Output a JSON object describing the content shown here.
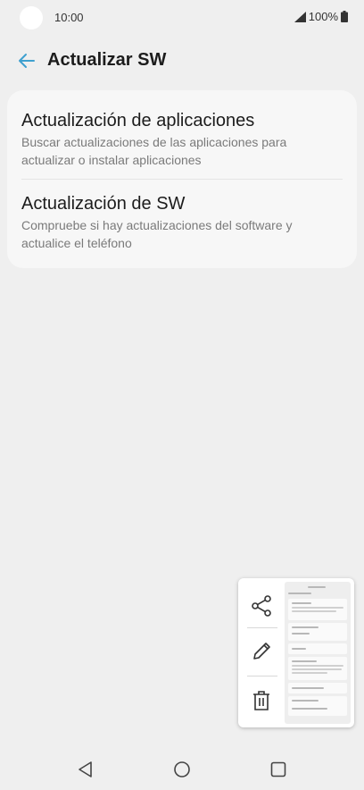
{
  "status_bar": {
    "time": "10:00",
    "battery": "100%"
  },
  "app_bar": {
    "title": "Actualizar SW",
    "back_icon": "arrow-left-icon",
    "accent_color": "#3ea0cf"
  },
  "settings": {
    "items": [
      {
        "title": "Actualización de aplicaciones",
        "description": "Buscar actualizaciones de las aplicaciones para actualizar o instalar aplicaciones"
      },
      {
        "title": "Actualización de SW",
        "description": "Compruebe si hay actualizaciones del software y actualice el teléfono"
      }
    ]
  },
  "capture_popup": {
    "actions": [
      "share-icon",
      "edit-icon",
      "delete-icon"
    ]
  },
  "nav_bar": {
    "buttons": [
      "back-icon",
      "home-icon",
      "recent-apps-icon"
    ]
  }
}
